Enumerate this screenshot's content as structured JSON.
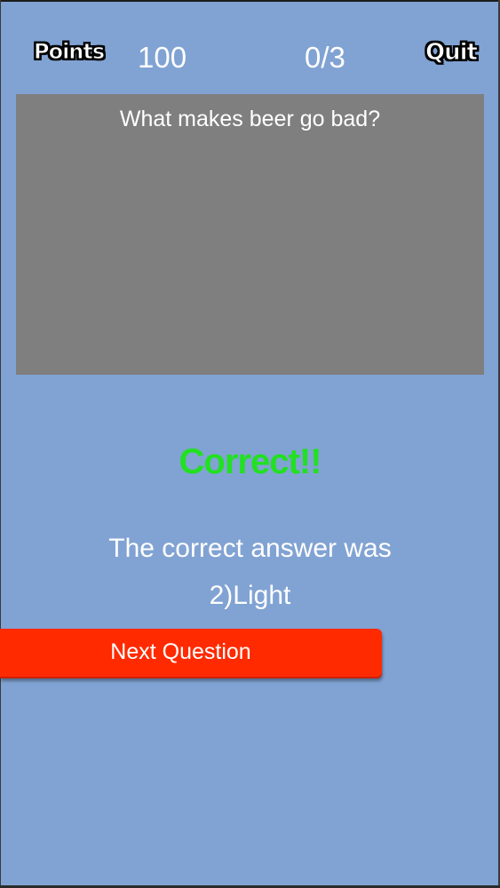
{
  "header": {
    "points_label": "Points",
    "score": "100",
    "progress": "0/3",
    "quit_label": "Quit"
  },
  "question": {
    "text": "What makes beer go bad?"
  },
  "result": {
    "status": "Correct!!",
    "answer_intro": "The correct answer was",
    "answer": "2)Light"
  },
  "actions": {
    "next_label": "Next Question"
  },
  "colors": {
    "background": "#81a3d3",
    "question_box": "#7f7f7f",
    "correct_text": "#22e022",
    "next_button": "#ff2a00"
  }
}
